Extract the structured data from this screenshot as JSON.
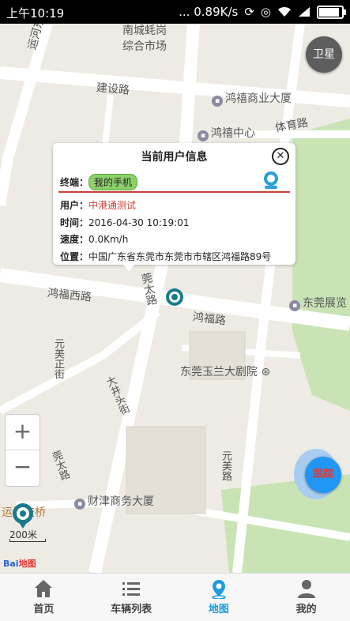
{
  "status_bar": {
    "time": "上午10:19",
    "network_speed": "... 0.89K/s",
    "battery_level": 0.95
  },
  "map": {
    "satellite_label": "卫星",
    "labels": {
      "market": "南城蚝岗\n综合市场",
      "road_yunhe": "运河东二路",
      "road_jianshe": "建设路",
      "building_hongxi_business": "鸿禧商业大厦",
      "building_hongxi_center": "鸿禧中心",
      "road_tiyu": "体育路",
      "road_hongfu_west": "鸿福西路",
      "road_hongfu": "鸿福路",
      "road_guantai": "莞太路",
      "exhibition": "东莞展览",
      "theatre": "东莞玉兰大剧院",
      "road_yuanmei": "元美正街",
      "road_dajing": "大井头街",
      "road_guantai2": "莞太路",
      "road_yuanmei2": "元美路",
      "building_caijin": "财津商务大厦",
      "bridge": "运河交桥"
    },
    "scale_label": "200米",
    "logo_text": "Bai",
    "logo_text2": "地图",
    "track_button": "跟踪"
  },
  "popup": {
    "title": "当前用户信息",
    "terminal_label": "终端：",
    "terminal_value": "我的手机",
    "user_label": "用户：",
    "user_value": "中港通测试",
    "time_label": "时间：",
    "time_value": "2016-04-30 10:19:01",
    "speed_label": "速度：",
    "speed_value": "0.0Km/h",
    "location_label": "位置：",
    "location_value": "中国广东省东莞市东莞市市辖区鸿福路89号"
  },
  "tabs": [
    {
      "label": "首页",
      "icon": "home-icon"
    },
    {
      "label": "车辆列表",
      "icon": "list-icon"
    },
    {
      "label": "地图",
      "icon": "map-pin-icon"
    },
    {
      "label": "我的",
      "icon": "user-icon"
    }
  ],
  "colors": {
    "accent": "#1e9be0",
    "popup_red": "#c8413b",
    "badge_green": "#8cd06a",
    "track_blue": "#2196f3"
  }
}
